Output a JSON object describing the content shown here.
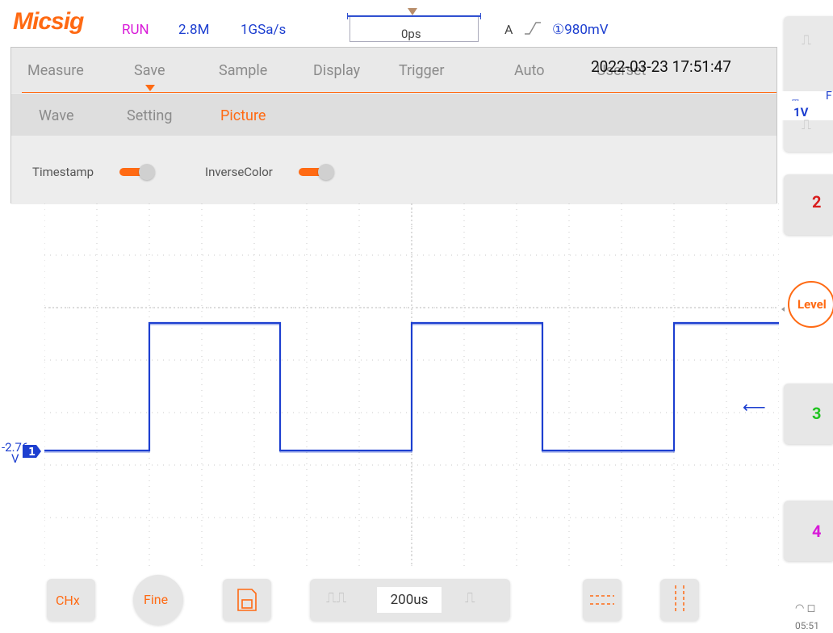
{
  "status": {
    "brand": "Micsig",
    "run_state": "RUN",
    "memory_depth": "2.8M",
    "sample_rate": "1GSa/s",
    "horizontal_offset": "0ps",
    "trigger_mode": "A",
    "trigger_level": "①980mV"
  },
  "menu": {
    "tabs": [
      "Measure",
      "Save",
      "Sample",
      "Display",
      "Trigger",
      "Auto",
      "Userset"
    ],
    "active_tab": "Save",
    "datetime": "2022-03-23 17:51:47",
    "subtabs": [
      "Wave",
      "Setting",
      "Picture"
    ],
    "active_subtab": "Picture",
    "options": {
      "timestamp_label": "Timestamp",
      "timestamp_on": true,
      "inverse_label": "InverseColor",
      "inverse_on": true
    }
  },
  "waveform": {
    "channel": "1",
    "offset_label": "-2.76",
    "offset_unit": "V",
    "color": "#1d3fd0",
    "low_level_div": 1.05,
    "high_level_div": -1.0,
    "edges_div": [
      -3.0,
      -0.5,
      2.0,
      4.5,
      7.0
    ],
    "first_state": "low"
  },
  "right_panel": {
    "ch1_scale": "1V",
    "ch1_coupling_icon": "dc-coupling-icon",
    "ch1_label_f": "F",
    "level_button": "Level",
    "ch2": "2",
    "ch2_color": "#d91e1e",
    "ch3": "3",
    "ch3_color": "#22c322",
    "ch4": "4",
    "ch4_color": "#d81bd8",
    "clock": "05:51"
  },
  "toolbar": {
    "chx": "CHx",
    "fine": "Fine",
    "timebase": "200us"
  },
  "colors": {
    "accent": "#ff6a13",
    "trace": "#1d3fd0",
    "grid_dot": "#c8c8c8"
  }
}
